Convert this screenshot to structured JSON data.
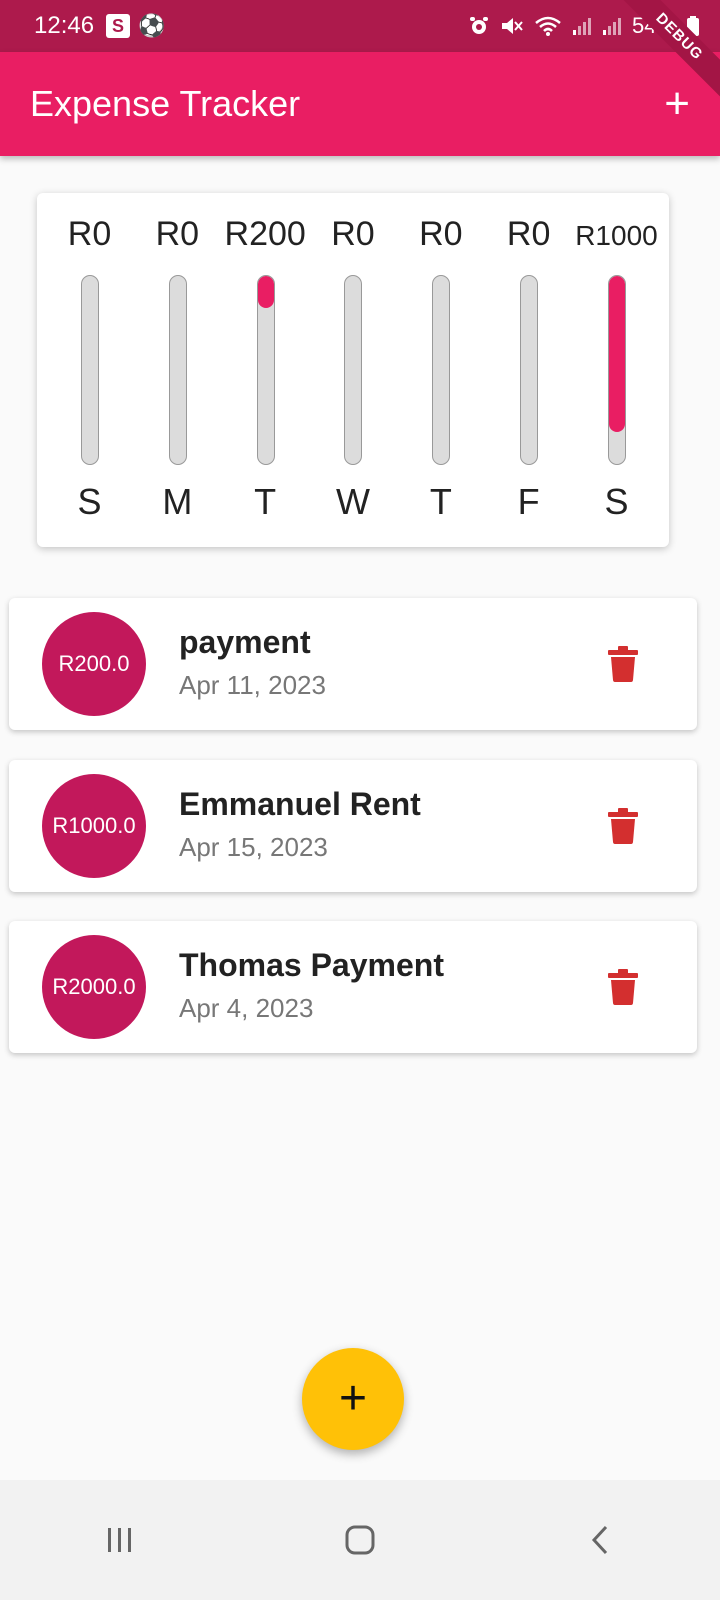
{
  "status_bar": {
    "time": "12:46",
    "badge": "S",
    "ball_icon": "⚽",
    "battery": "54%",
    "debug_label": "DEBUG"
  },
  "app_bar": {
    "title": "Expense Tracker",
    "add_label": "+"
  },
  "chart": {
    "bars": [
      {
        "amount": "R0",
        "day": "S",
        "fill": 0.0
      },
      {
        "amount": "R0",
        "day": "M",
        "fill": 0.0
      },
      {
        "amount": "R200",
        "day": "T",
        "fill": 0.17
      },
      {
        "amount": "R0",
        "day": "W",
        "fill": 0.0
      },
      {
        "amount": "R0",
        "day": "T",
        "fill": 0.0
      },
      {
        "amount": "R0",
        "day": "F",
        "fill": 0.0
      },
      {
        "amount": "R1000",
        "day": "S",
        "fill": 0.83
      }
    ],
    "bar_color": "#e91e63"
  },
  "transactions": [
    {
      "amount": "R200.0",
      "title": "payment",
      "date": "Apr 11, 2023"
    },
    {
      "amount": "R1000.0",
      "title": "Emmanuel Rent",
      "date": "Apr 15, 2023"
    },
    {
      "amount": "R2000.0",
      "title": "Thomas Payment",
      "date": "Apr 4, 2023"
    }
  ],
  "fab": {
    "label": "+"
  },
  "colors": {
    "primary": "#e91e63",
    "status": "#ad1a4c",
    "avatar": "#c2185b",
    "fab": "#ffc107",
    "delete": "#d32f2f"
  }
}
